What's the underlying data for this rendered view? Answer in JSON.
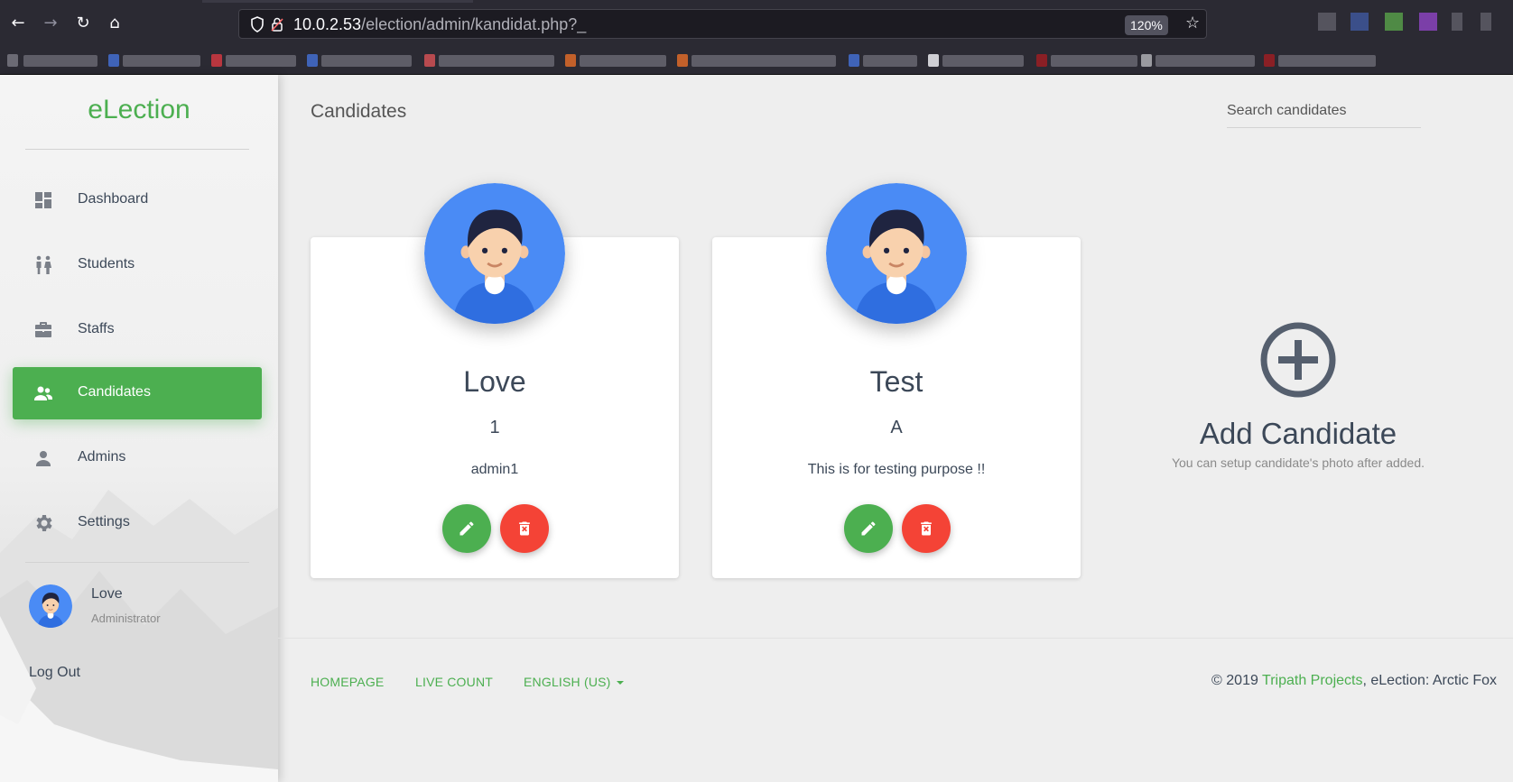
{
  "browser": {
    "url_host": "10.0.2.53",
    "url_path": "/election/admin/kandidat.php?_",
    "zoom": "120%"
  },
  "sidebar": {
    "brand": "eLection",
    "items": [
      {
        "label": "Dashboard",
        "icon": "dashboard-icon",
        "active": false
      },
      {
        "label": "Students",
        "icon": "students-icon",
        "active": false
      },
      {
        "label": "Staffs",
        "icon": "briefcase-icon",
        "active": false
      },
      {
        "label": "Candidates",
        "icon": "people-icon",
        "active": true
      },
      {
        "label": "Admins",
        "icon": "person-icon",
        "active": false
      },
      {
        "label": "Settings",
        "icon": "gear-icon",
        "active": false
      }
    ],
    "user": {
      "name": "Love",
      "role": "Administrator"
    },
    "logout_label": "Log Out"
  },
  "main": {
    "title": "Candidates",
    "search": {
      "placeholder": "Search candidates"
    },
    "candidates": [
      {
        "name": "Love",
        "number": "1",
        "description": "admin1"
      },
      {
        "name": "Test",
        "number": "A",
        "description": "This is for testing purpose !!"
      }
    ],
    "add_card": {
      "title": "Add Candidate",
      "subtitle": "You can setup candidate's photo after added."
    }
  },
  "footer": {
    "links": [
      "HOMEPAGE",
      "LIVE COUNT",
      "ENGLISH (US)"
    ],
    "copyright_prefix": "© 2019 ",
    "copyright_link": "Tripath Projects",
    "copyright_suffix": ", eLection: Arctic Fox"
  },
  "colors": {
    "accent": "#4caf50",
    "danger": "#f44336",
    "text": "#3c4858",
    "avatar_blue": "#4a8bf5"
  }
}
